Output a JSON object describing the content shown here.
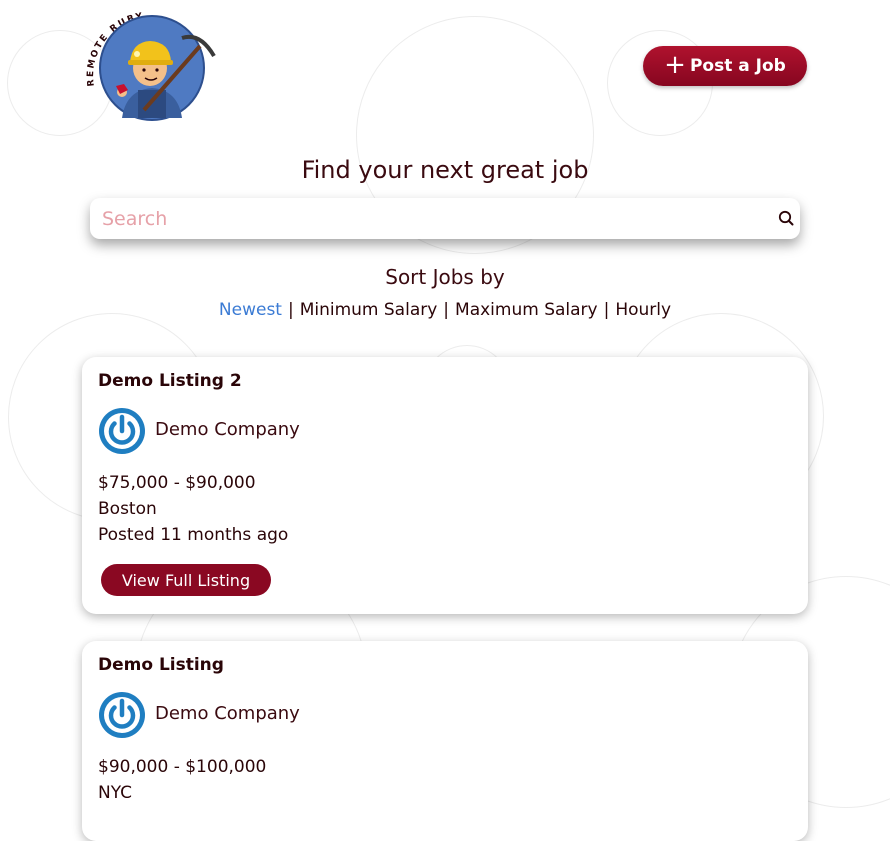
{
  "header": {
    "logo_text": "REMOTE RUBY",
    "post_button_label": "Post a Job"
  },
  "hero": {
    "headline": "Find your next great job"
  },
  "search": {
    "placeholder": "Search",
    "value": ""
  },
  "sort": {
    "title": "Sort Jobs by",
    "options": [
      "Newest",
      "Minimum Salary",
      "Maximum Salary",
      "Hourly"
    ],
    "separator": "|",
    "active": "Newest"
  },
  "listings": [
    {
      "title": "Demo Listing 2",
      "company": "Demo Company",
      "salary": "$75,000 - $90,000",
      "location": "Boston",
      "posted": "Posted 11 months ago",
      "button_label": "View Full Listing"
    },
    {
      "title": "Demo Listing",
      "company": "Demo Company",
      "salary": "$90,000 - $100,000",
      "location": "NYC"
    }
  ],
  "colors": {
    "brand": "#8a0822",
    "text": "#3a0a10",
    "active_sort": "#3b7bd4",
    "placeholder": "#e6a1a8",
    "company_logo": "#1f7ec1"
  },
  "icons": {
    "search": "search-icon",
    "plus": "plus-icon",
    "company_logo": "power-icon"
  }
}
